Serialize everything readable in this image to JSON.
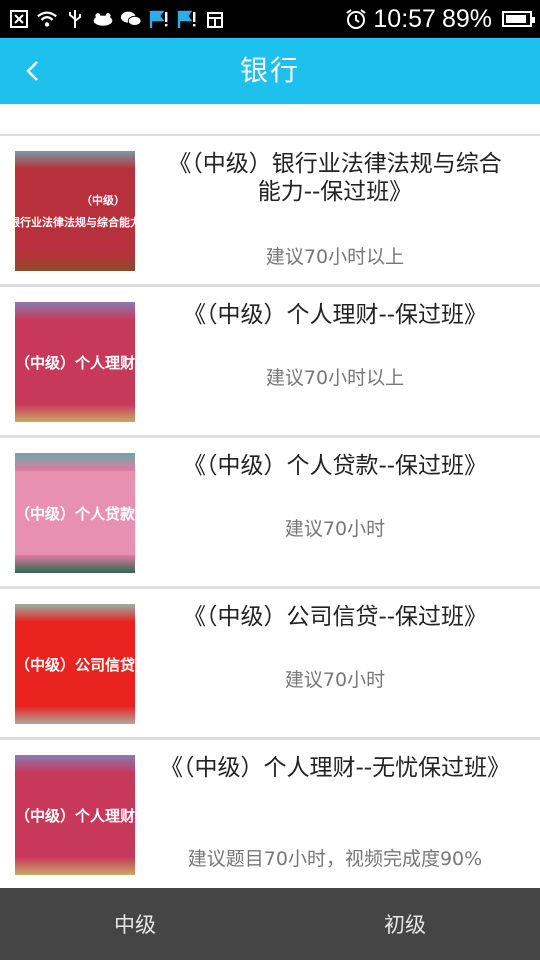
{
  "status_bar": {
    "time": "10:57",
    "battery_percent": "89%",
    "battery_level": 0.89,
    "icons": [
      "close-box-icon",
      "wifi-icon",
      "usb-icon",
      "baidu-icon",
      "wechat-icon",
      "notification-flag-icon",
      "notification-flag-icon",
      "calendar-icon",
      "alarm-icon",
      "battery-icon"
    ]
  },
  "header": {
    "title": "银行",
    "accent_color": "#1ec0ee"
  },
  "courses": [
    {
      "title": "《（中级）银行业法律法规与综合能力--保过班》",
      "hint": "建议70小时以上",
      "thumb_text_line1": "（中级）",
      "thumb_text_line2": "银行业法律法规与综合能力",
      "thumb_color": "#b8303c"
    },
    {
      "title": "《（中级）个人理财--保过班》",
      "hint": "建议70小时以上",
      "thumb_text": "（中级）个人理财",
      "thumb_color": "#c8385a"
    },
    {
      "title": "《（中级）个人贷款--保过班》",
      "hint": "建议70小时",
      "thumb_text": "（中级）个人贷款",
      "thumb_color": "#e37aa0"
    },
    {
      "title": "《（中级）公司信贷--保过班》",
      "hint": "建议70小时",
      "thumb_text": "（中级）公司信贷",
      "thumb_color": "#e8231f"
    },
    {
      "title": "《（中级）个人理财--无忧保过班》",
      "hint": "建议题目70小时，视频完成度90%",
      "thumb_text": "（中级）个人理财",
      "thumb_color": "#c8385a"
    }
  ],
  "tabs": [
    {
      "label": "中级"
    },
    {
      "label": "初级"
    }
  ]
}
